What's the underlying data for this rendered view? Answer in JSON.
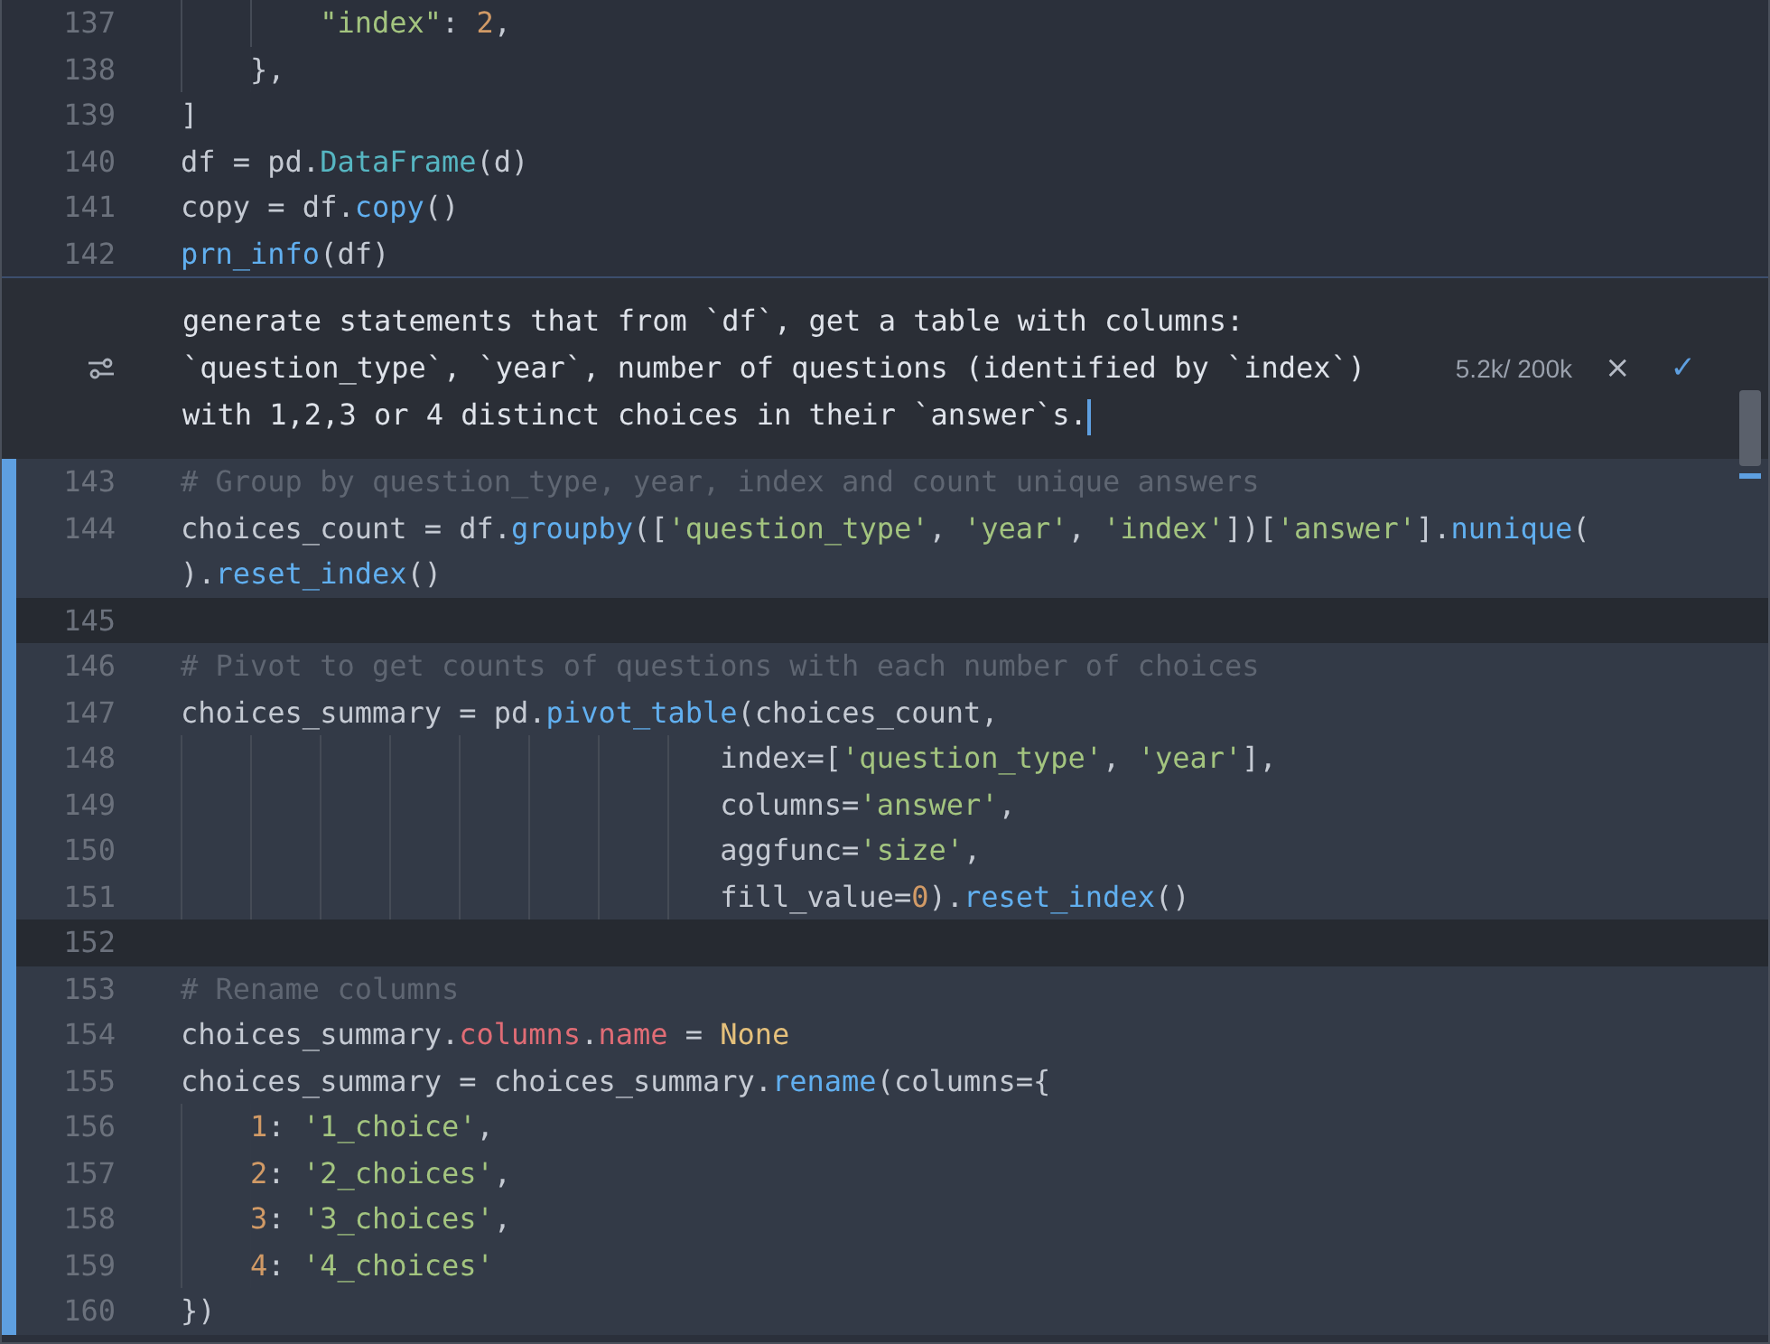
{
  "code_above": [
    {
      "number": "137",
      "added": false,
      "tokens": [
        {
          "kind": "string",
          "text": "        \"index\""
        },
        {
          "kind": "plain",
          "text": ": "
        },
        {
          "kind": "number",
          "text": "2"
        },
        {
          "kind": "plain",
          "text": ","
        }
      ]
    },
    {
      "number": "138",
      "added": false,
      "tokens": [
        {
          "kind": "plain",
          "text": "    },"
        }
      ]
    },
    {
      "number": "139",
      "added": false,
      "tokens": [
        {
          "kind": "plain",
          "text": "]"
        }
      ]
    },
    {
      "number": "140",
      "added": false,
      "tokens": [
        {
          "kind": "plain",
          "text": "df = pd."
        },
        {
          "kind": "class",
          "text": "DataFrame"
        },
        {
          "kind": "plain",
          "text": "(d)"
        }
      ]
    },
    {
      "number": "141",
      "added": false,
      "tokens": [
        {
          "kind": "plain",
          "text": "copy = df."
        },
        {
          "kind": "function",
          "text": "copy"
        },
        {
          "kind": "plain",
          "text": "()"
        }
      ]
    },
    {
      "number": "142",
      "added": false,
      "tokens": [
        {
          "kind": "function",
          "text": "prn_info"
        },
        {
          "kind": "plain",
          "text": "(df)"
        }
      ]
    }
  ],
  "prompt": {
    "text": "generate statements that from `df`, get a table with columns:\n`question_type`, `year`, number of questions (identified by `index`)\nwith 1,2,3 or 4 distinct choices in their `answer`s.",
    "token_count": "5.2k/ 200k",
    "reject": "×",
    "accept": "✓"
  },
  "code_below": [
    {
      "number": "143",
      "added": true,
      "tokens": [
        {
          "kind": "comment",
          "text": "# Group by question_type, year, index and count unique answers"
        }
      ]
    },
    {
      "number": "144",
      "added": true,
      "tokens": [
        {
          "kind": "plain",
          "text": "choices_count = df."
        },
        {
          "kind": "function",
          "text": "groupby"
        },
        {
          "kind": "plain",
          "text": "(["
        },
        {
          "kind": "string",
          "text": "'question_type'"
        },
        {
          "kind": "plain",
          "text": ", "
        },
        {
          "kind": "string",
          "text": "'year'"
        },
        {
          "kind": "plain",
          "text": ", "
        },
        {
          "kind": "string",
          "text": "'index'"
        },
        {
          "kind": "plain",
          "text": "])["
        },
        {
          "kind": "string",
          "text": "'answer'"
        },
        {
          "kind": "plain",
          "text": "]."
        },
        {
          "kind": "function",
          "text": "nunique"
        },
        {
          "kind": "plain",
          "text": "("
        }
      ],
      "wrap_tokens": [
        {
          "kind": "plain",
          "text": ")."
        },
        {
          "kind": "function",
          "text": "reset_index"
        },
        {
          "kind": "plain",
          "text": "()"
        }
      ]
    },
    {
      "number": "145",
      "added": true
    },
    {
      "number": "146",
      "added": true,
      "tokens": [
        {
          "kind": "comment",
          "text": "# Pivot to get counts of questions with each number of choices"
        }
      ]
    },
    {
      "number": "147",
      "added": true,
      "tokens": [
        {
          "kind": "plain",
          "text": "choices_summary = pd."
        },
        {
          "kind": "function",
          "text": "pivot_table"
        },
        {
          "kind": "plain",
          "text": "(choices_count,"
        }
      ]
    },
    {
      "number": "148",
      "added": true,
      "tokens": [
        {
          "kind": "plain",
          "text": "                               index=["
        },
        {
          "kind": "string",
          "text": "'question_type'"
        },
        {
          "kind": "plain",
          "text": ", "
        },
        {
          "kind": "string",
          "text": "'year'"
        },
        {
          "kind": "plain",
          "text": "],"
        }
      ]
    },
    {
      "number": "149",
      "added": true,
      "tokens": [
        {
          "kind": "plain",
          "text": "                               columns="
        },
        {
          "kind": "string",
          "text": "'answer'"
        },
        {
          "kind": "plain",
          "text": ","
        }
      ]
    },
    {
      "number": "150",
      "added": true,
      "tokens": [
        {
          "kind": "plain",
          "text": "                               aggfunc="
        },
        {
          "kind": "string",
          "text": "'size'"
        },
        {
          "kind": "plain",
          "text": ","
        }
      ]
    },
    {
      "number": "151",
      "added": true,
      "tokens": [
        {
          "kind": "plain",
          "text": "                               fill_value="
        },
        {
          "kind": "number",
          "text": "0"
        },
        {
          "kind": "plain",
          "text": ")."
        },
        {
          "kind": "function",
          "text": "reset_index"
        },
        {
          "kind": "plain",
          "text": "()"
        }
      ]
    },
    {
      "number": "152",
      "added": true
    },
    {
      "number": "153",
      "added": true,
      "tokens": [
        {
          "kind": "comment",
          "text": "# Rename columns"
        }
      ]
    },
    {
      "number": "154",
      "added": true,
      "tokens": [
        {
          "kind": "plain",
          "text": "choices_summary."
        },
        {
          "kind": "attribute",
          "text": "columns"
        },
        {
          "kind": "plain",
          "text": "."
        },
        {
          "kind": "attribute",
          "text": "name"
        },
        {
          "kind": "plain",
          "text": " = "
        },
        {
          "kind": "constant",
          "text": "None"
        }
      ]
    },
    {
      "number": "155",
      "added": true,
      "tokens": [
        {
          "kind": "plain",
          "text": "choices_summary = choices_summary."
        },
        {
          "kind": "function",
          "text": "rename"
        },
        {
          "kind": "plain",
          "text": "(columns={"
        }
      ]
    },
    {
      "number": "156",
      "added": true,
      "tokens": [
        {
          "kind": "number",
          "text": "    1"
        },
        {
          "kind": "plain",
          "text": ": "
        },
        {
          "kind": "string",
          "text": "'1_choice'"
        },
        {
          "kind": "plain",
          "text": ","
        }
      ]
    },
    {
      "number": "157",
      "added": true,
      "tokens": [
        {
          "kind": "number",
          "text": "    2"
        },
        {
          "kind": "plain",
          "text": ": "
        },
        {
          "kind": "string",
          "text": "'2_choices'"
        },
        {
          "kind": "plain",
          "text": ","
        }
      ]
    },
    {
      "number": "158",
      "added": true,
      "tokens": [
        {
          "kind": "number",
          "text": "    3"
        },
        {
          "kind": "plain",
          "text": ": "
        },
        {
          "kind": "string",
          "text": "'3_choices'"
        },
        {
          "kind": "plain",
          "text": ","
        }
      ]
    },
    {
      "number": "159",
      "added": true,
      "tokens": [
        {
          "kind": "number",
          "text": "    4"
        },
        {
          "kind": "plain",
          "text": ": "
        },
        {
          "kind": "string",
          "text": "'4_choices'"
        }
      ]
    },
    {
      "number": "160",
      "added": true,
      "tokens": [
        {
          "kind": "plain",
          "text": "})"
        }
      ]
    }
  ]
}
